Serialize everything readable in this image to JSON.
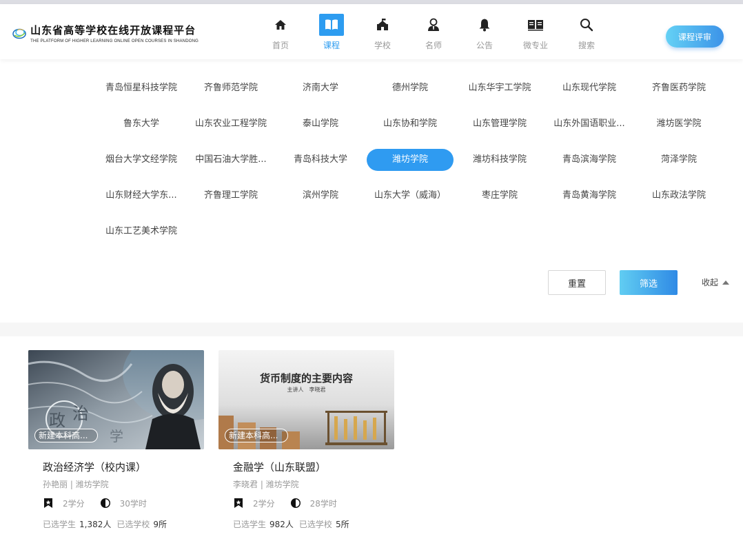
{
  "header": {
    "logo_cn": "山东省高等学校在线开放课程平台",
    "logo_en": "THE PLATFORM OF HIGHER LEARNING ONLINE OPEN COURSES IN SHANDONG",
    "nav": [
      {
        "label": "首页",
        "icon": "home-icon"
      },
      {
        "label": "课程",
        "icon": "book-icon",
        "active": true
      },
      {
        "label": "学校",
        "icon": "school-icon"
      },
      {
        "label": "名师",
        "icon": "teacher-icon"
      },
      {
        "label": "公告",
        "icon": "bell-icon"
      },
      {
        "label": "微专业",
        "icon": "open-book-icon"
      },
      {
        "label": "搜索",
        "icon": "search-icon"
      }
    ],
    "review_button": "课程评审"
  },
  "schools": [
    "青岛恒星科技学院",
    "齐鲁师范学院",
    "济南大学",
    "德州学院",
    "山东华宇工学院",
    "山东现代学院",
    "齐鲁医药学院",
    "鲁东大学",
    "山东农业工程学院",
    "泰山学院",
    "山东协和学院",
    "山东管理学院",
    "山东外国语职业...",
    "潍坊医学院",
    "烟台大学文经学院",
    "中国石油大学胜...",
    "青岛科技大学",
    "潍坊学院",
    "潍坊科技学院",
    "青岛滨海学院",
    "菏泽学院",
    "山东财经大学东...",
    "齐鲁理工学院",
    "滨州学院",
    "山东大学（威海）",
    "枣庄学院",
    "青岛黄海学院",
    "山东政法学院",
    "山东工艺美术学院"
  ],
  "selected_school": "潍坊学院",
  "filter": {
    "reset": "重置",
    "apply": "筛选",
    "collapse": "收起"
  },
  "courses": [
    {
      "title": "政治经济学（校内课）",
      "meta": "孙艳丽 | 潍坊学院",
      "tag": "新建本科高...",
      "credits": "2学分",
      "hours": "30学时",
      "students_label": "已选学生",
      "students": "1,382人",
      "schools_label": "已选学校",
      "schools": "9所"
    },
    {
      "title": "金融学（山东联盟）",
      "meta": "李晓君 | 潍坊学院",
      "tag": "新建本科高...",
      "thumb_title": "货币制度的主要内容",
      "thumb_sub": "主讲人　李晓君",
      "credits": "2学分",
      "hours": "28学时",
      "students_label": "已选学生",
      "students": "982人",
      "schools_label": "已选学校",
      "schools": "5所"
    }
  ],
  "colors": {
    "accent": "#2d9cf0",
    "nav_inactive": "#999999",
    "divider": "#f6f6f6"
  }
}
